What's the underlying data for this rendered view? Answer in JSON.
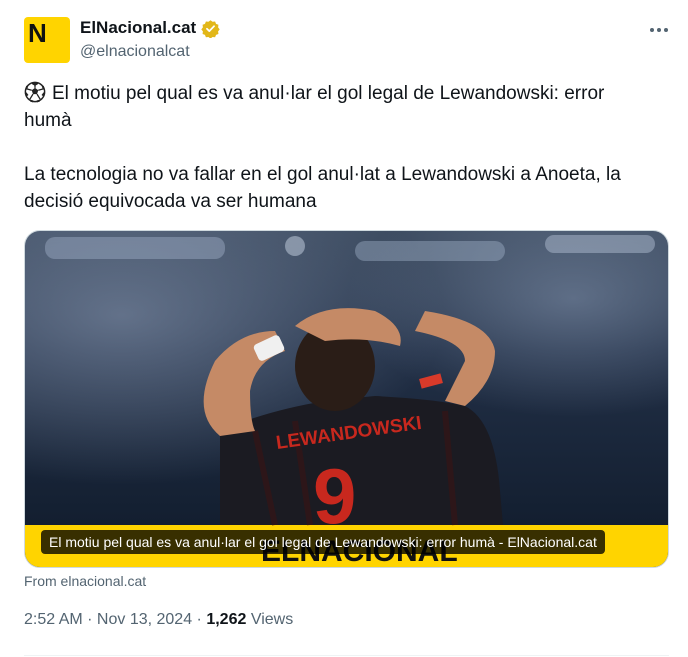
{
  "author": {
    "display_name": "ElNacional.cat",
    "handle": "@elnacionalcat",
    "avatar_letter": "N",
    "avatar_color": "#ffd400",
    "verified_badge": "gold-verified-icon"
  },
  "tweet": {
    "line1": "El motiu pel qual es va anul·lar el gol legal de Lewandowski: error humà",
    "line2": "La tecnologia no va fallar en el gol anul·lat a Lewandowski a Anoeta, la decisió equivocada va ser humana",
    "emoji": "soccer-ball-icon"
  },
  "card": {
    "caption": "El motiu pel qual es va anul·lar el gol legal de Lewandowski: error humà - ElNacional.cat",
    "source": "From elnacional.cat",
    "jersey_name": "LEWANDOWSKI",
    "jersey_number": "9",
    "watermark": "ELNACIONAL"
  },
  "meta": {
    "time": "2:52 AM",
    "separator1": " · ",
    "date": "Nov 13, 2024",
    "separator2": " · ",
    "views_count": "1,262",
    "views_label": " Views"
  },
  "colors": {
    "text_primary": "#0f1419",
    "text_secondary": "#536471",
    "brand_yellow": "#ffd400"
  }
}
